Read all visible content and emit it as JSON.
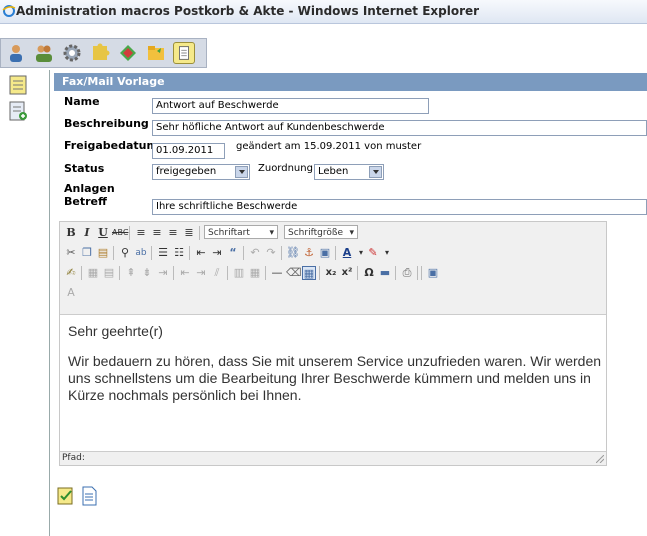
{
  "window": {
    "title": "Administration macros Postkorb & Akte - Windows Internet Explorer"
  },
  "toolbar": {
    "icons": [
      "user-icon",
      "users-icon",
      "gear-icon",
      "puzzle-icon",
      "tag-icon",
      "folder-icon",
      "notepad-icon"
    ]
  },
  "sidebar": {
    "icons": [
      "notepad-icon",
      "notepad-add-icon"
    ]
  },
  "section": {
    "title": "Fax/Mail Vorlage"
  },
  "form": {
    "name_label": "Name",
    "name_value": "Antwort auf Beschwerde",
    "beschreibung_label": "Beschreibung",
    "beschreibung_value": "Sehr höfliche Antwort auf Kundenbeschwerde",
    "freigabedatum_label": "Freigabedatum",
    "freigabedatum_value": "01.09.2011",
    "geaendert_text": "geändert am  15.09.2011  von  muster",
    "status_label": "Status",
    "status_value": "freigegeben",
    "zuordnung_label": "Zuordnung",
    "zuordnung_value": "Leben",
    "anlagen_label": "Anlagen",
    "betreff_label": "Betreff",
    "betreff_value": "Ihre schriftliche Beschwerde"
  },
  "editor": {
    "font_select": "Schriftart",
    "size_select": "Schriftgröße",
    "content_line1": "Sehr geehrte(r)",
    "content_line2": "Wir bedauern zu hören, dass Sie mit unserem Service unzufrieden waren. Wir werden",
    "content_line3": "uns schnellstens um die Bearbeitung Ihrer Beschwerde kümmern und melden uns in",
    "content_line4": "Kürze nochmals persönlich bei Ihnen.",
    "path_label": "Pfad:"
  },
  "footer": {
    "icons": [
      "edit-check-icon",
      "document-icon"
    ]
  }
}
